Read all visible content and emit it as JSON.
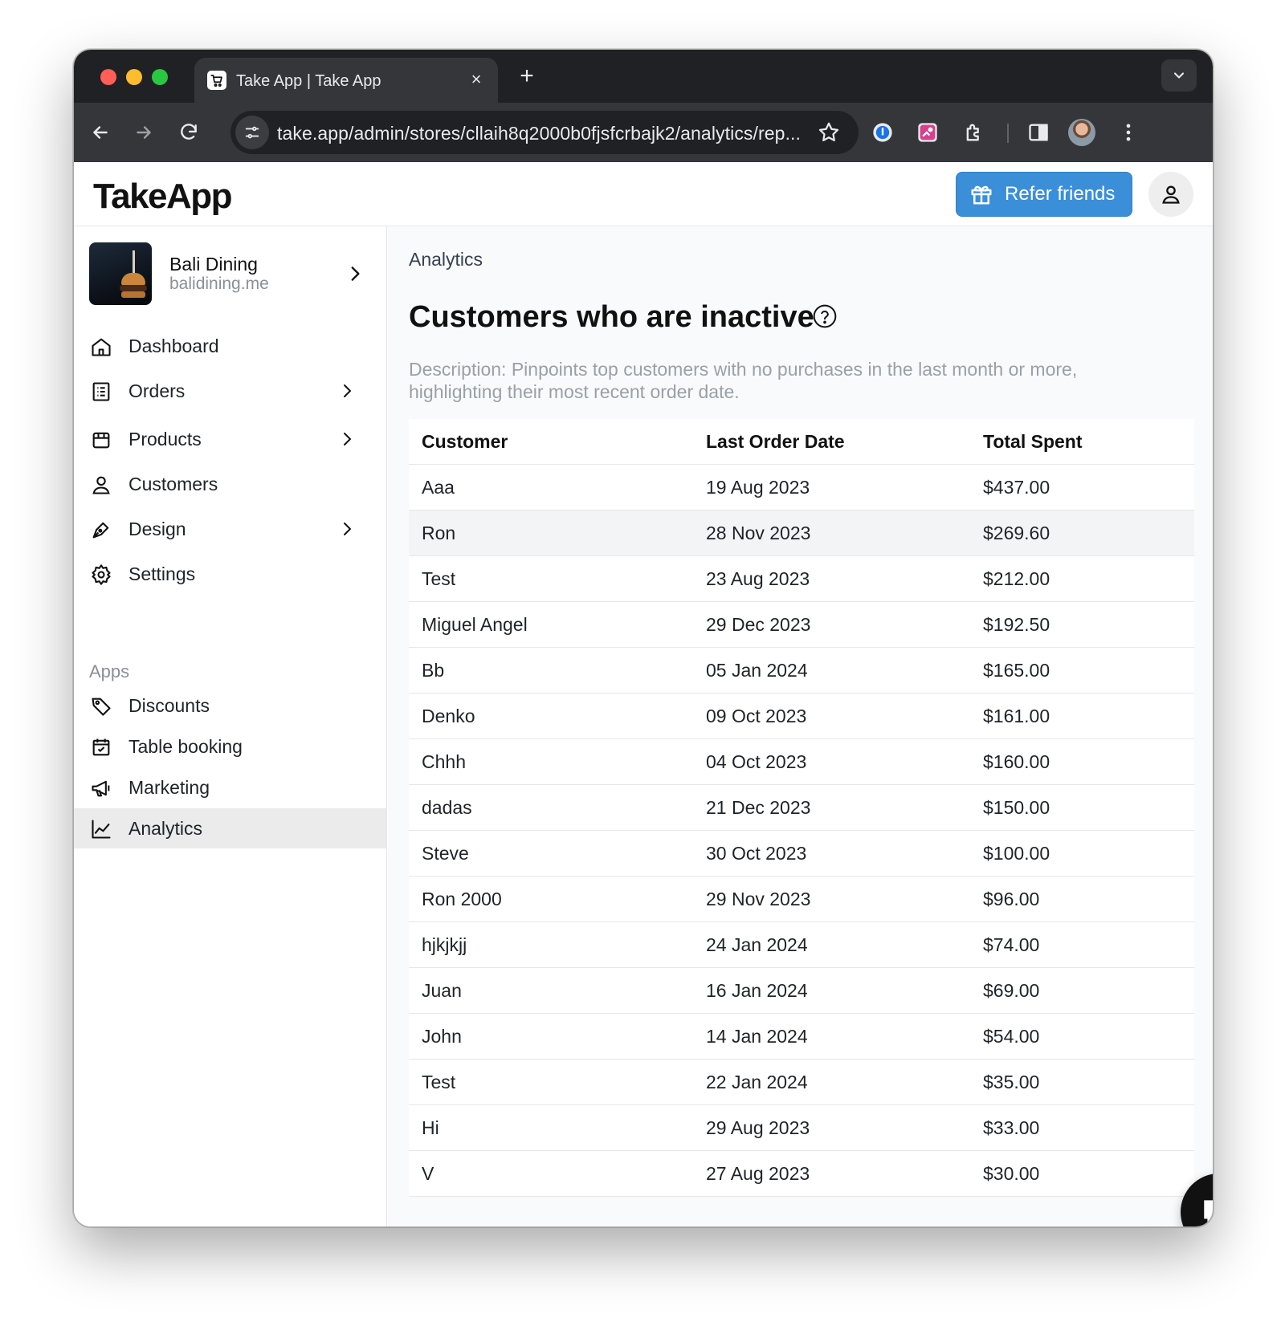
{
  "browser": {
    "tab_title": "Take App | Take App",
    "tab_close": "×",
    "new_tab": "+",
    "url": "take.app/admin/stores/cllaih8q2000b0fjsfcrbajk2/analytics/rep..."
  },
  "header": {
    "logo": "TakeApp",
    "refer_label": "Refer friends"
  },
  "store": {
    "name": "Bali Dining",
    "domain": "balidining.me"
  },
  "sidebar": {
    "items": [
      {
        "label": "Dashboard",
        "icon": "home-icon"
      },
      {
        "label": "Orders",
        "icon": "orders-list-icon",
        "has_submenu": true
      },
      {
        "label": "Products",
        "icon": "box-icon",
        "has_submenu": true
      },
      {
        "label": "Customers",
        "icon": "user-icon"
      },
      {
        "label": "Design",
        "icon": "pen-icon",
        "has_submenu": true
      },
      {
        "label": "Settings",
        "icon": "gear-icon"
      }
    ],
    "apps_label": "Apps",
    "apps": [
      {
        "label": "Discounts",
        "icon": "tag-icon"
      },
      {
        "label": "Table booking",
        "icon": "calendar-check-icon"
      },
      {
        "label": "Marketing",
        "icon": "megaphone-icon"
      },
      {
        "label": "Analytics",
        "icon": "chart-line-icon",
        "active": true
      }
    ]
  },
  "main": {
    "breadcrumb": "Analytics",
    "title": "Customers who are inactive",
    "description": "Description: Pinpoints top customers with no purchases in the last month or more, highlighting their most recent order date.",
    "table": {
      "columns": [
        "Customer",
        "Last Order Date",
        "Total Spent"
      ],
      "rows": [
        [
          "Aaa",
          "19 Aug 2023",
          "$437.00"
        ],
        [
          "Ron",
          "28 Nov 2023",
          "$269.60"
        ],
        [
          "Test",
          "23 Aug 2023",
          "$212.00"
        ],
        [
          "Miguel Angel",
          "29 Dec 2023",
          "$192.50"
        ],
        [
          "Bb",
          "05 Jan 2024",
          "$165.00"
        ],
        [
          "Denko",
          "09 Oct 2023",
          "$161.00"
        ],
        [
          "Chhh",
          "04 Oct 2023",
          "$160.00"
        ],
        [
          "dadas",
          "21 Dec 2023",
          "$150.00"
        ],
        [
          "Steve",
          "30 Oct 2023",
          "$100.00"
        ],
        [
          "Ron 2000",
          "29 Nov 2023",
          "$96.00"
        ],
        [
          "hjkjkjj",
          "24 Jan 2024",
          "$74.00"
        ],
        [
          "Juan",
          "16 Jan 2024",
          "$69.00"
        ],
        [
          "John",
          "14 Jan 2024",
          "$54.00"
        ],
        [
          "Test",
          "22 Jan 2024",
          "$35.00"
        ],
        [
          "Hi",
          "29 Aug 2023",
          "$33.00"
        ],
        [
          "V",
          "27 Aug 2023",
          "$30.00"
        ]
      ]
    }
  },
  "colors": {
    "accent": "#3b8fd9",
    "chrome_dark": "#202124",
    "chrome_toolbar": "#35363a"
  }
}
